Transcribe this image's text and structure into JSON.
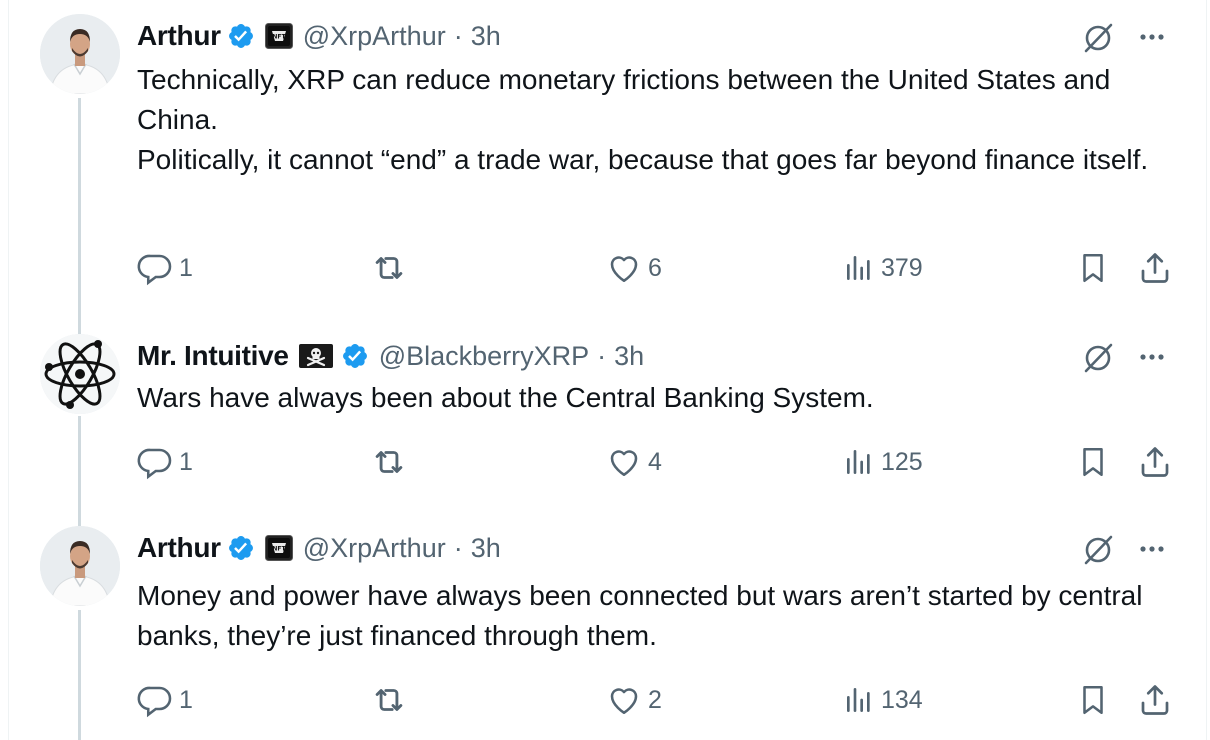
{
  "colors": {
    "text": "#0f1419",
    "secondary": "#536471",
    "verified": "#1d9bf0",
    "thread_line": "#cfd9de"
  },
  "tweets": [
    {
      "name": "Arthur",
      "handle": "@XrpArthur",
      "separator": "·",
      "time": "3h",
      "avatar": "avatar-photo-man-white-shirt",
      "affiliate_badge": "nft-badge-icon",
      "text": "Technically, XRP can reduce monetary frictions between the United States and China.\nPolitically, it cannot “end” a trade war, because that goes far beyond finance itself.",
      "replies": "1",
      "likes": "6",
      "views": "379"
    },
    {
      "name": "Mr. Intuitive",
      "handle": "@BlackberryXRP",
      "separator": "·",
      "time": "3h",
      "avatar": "atom-logo",
      "name_emoji": "pirate-flag-icon",
      "text": "Wars have always been about the Central Banking System.",
      "replies": "1",
      "likes": "4",
      "views": "125"
    },
    {
      "name": "Arthur",
      "handle": "@XrpArthur",
      "separator": "·",
      "time": "3h",
      "avatar": "avatar-photo-man-white-shirt",
      "affiliate_badge": "nft-badge-icon",
      "text": "Money and power have always been connected but wars aren’t started by central banks, they’re just financed through them.",
      "replies": "1",
      "likes": "2",
      "views": "134"
    }
  ]
}
